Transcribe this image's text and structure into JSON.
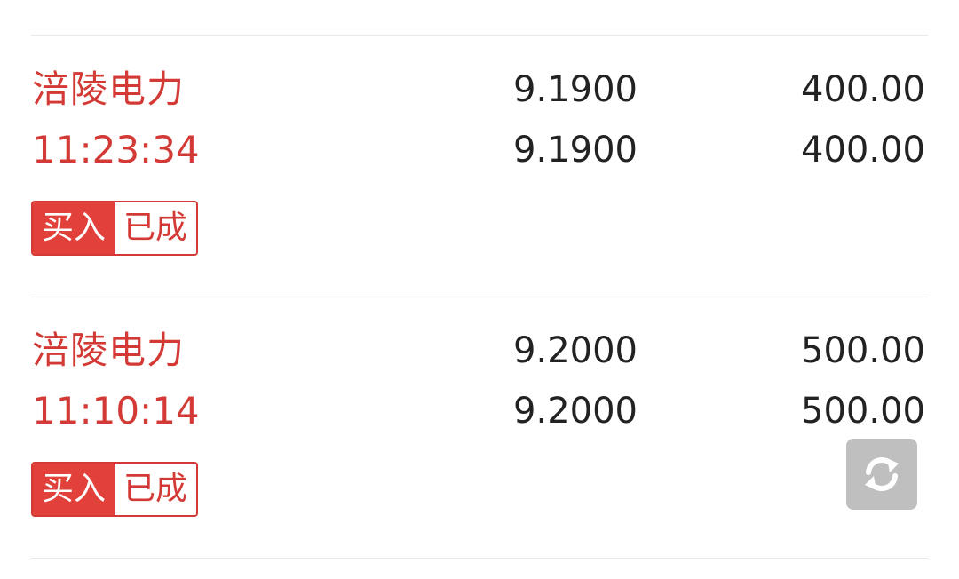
{
  "orders": [
    {
      "stock_name": "涪陵电力",
      "time": "11:23:34",
      "order_price": "9.1900",
      "order_quantity": "400.00",
      "deal_price": "9.1900",
      "deal_quantity": "400.00",
      "direction": "买入",
      "status": "已成"
    },
    {
      "stock_name": "涪陵电力",
      "time": "11:10:14",
      "order_price": "9.2000",
      "order_quantity": "500.00",
      "deal_price": "9.2000",
      "deal_quantity": "500.00",
      "direction": "买入",
      "status": "已成"
    }
  ],
  "refresh_button": {
    "icon": "refresh-icon"
  },
  "colors": {
    "accent_red": "#d33a36",
    "badge_fill": "#e2403a",
    "number_text": "#222222",
    "divider": "#e8e8e8",
    "refresh_bg": "#bfbfbf"
  }
}
